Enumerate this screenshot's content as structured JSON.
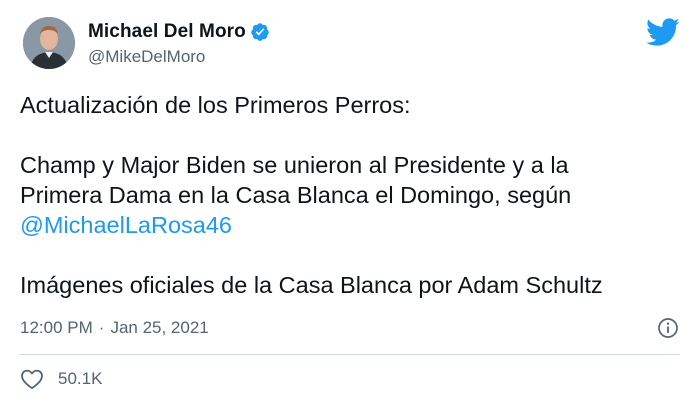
{
  "author": {
    "display_name": "Michael Del Moro",
    "handle": "@MikeDelMoro",
    "verified": true
  },
  "tweet": {
    "line_title": "Actualización de los Primeros Perros:",
    "line_body_1": "Champ y Major Biden se unieron al Presidente y a la",
    "line_body_2": "Primera Dama en la Casa Blanca el Domingo, según",
    "mention": "@MichaelLaRosa46",
    "line_credit": "Imágenes oficiales de la Casa Blanca por Adam Schultz"
  },
  "meta": {
    "time": "12:00 PM",
    "separator": "·",
    "date": "Jan 25, 2021"
  },
  "engagement": {
    "likes": "50.1K"
  },
  "icons": {
    "brand": "twitter-bird-icon",
    "verified": "verified-badge-icon",
    "info": "info-icon",
    "like": "heart-icon"
  },
  "colors": {
    "accent": "#1d9bf0",
    "text": "#0f1419",
    "secondary": "#536471",
    "divider": "#cfd9de"
  }
}
